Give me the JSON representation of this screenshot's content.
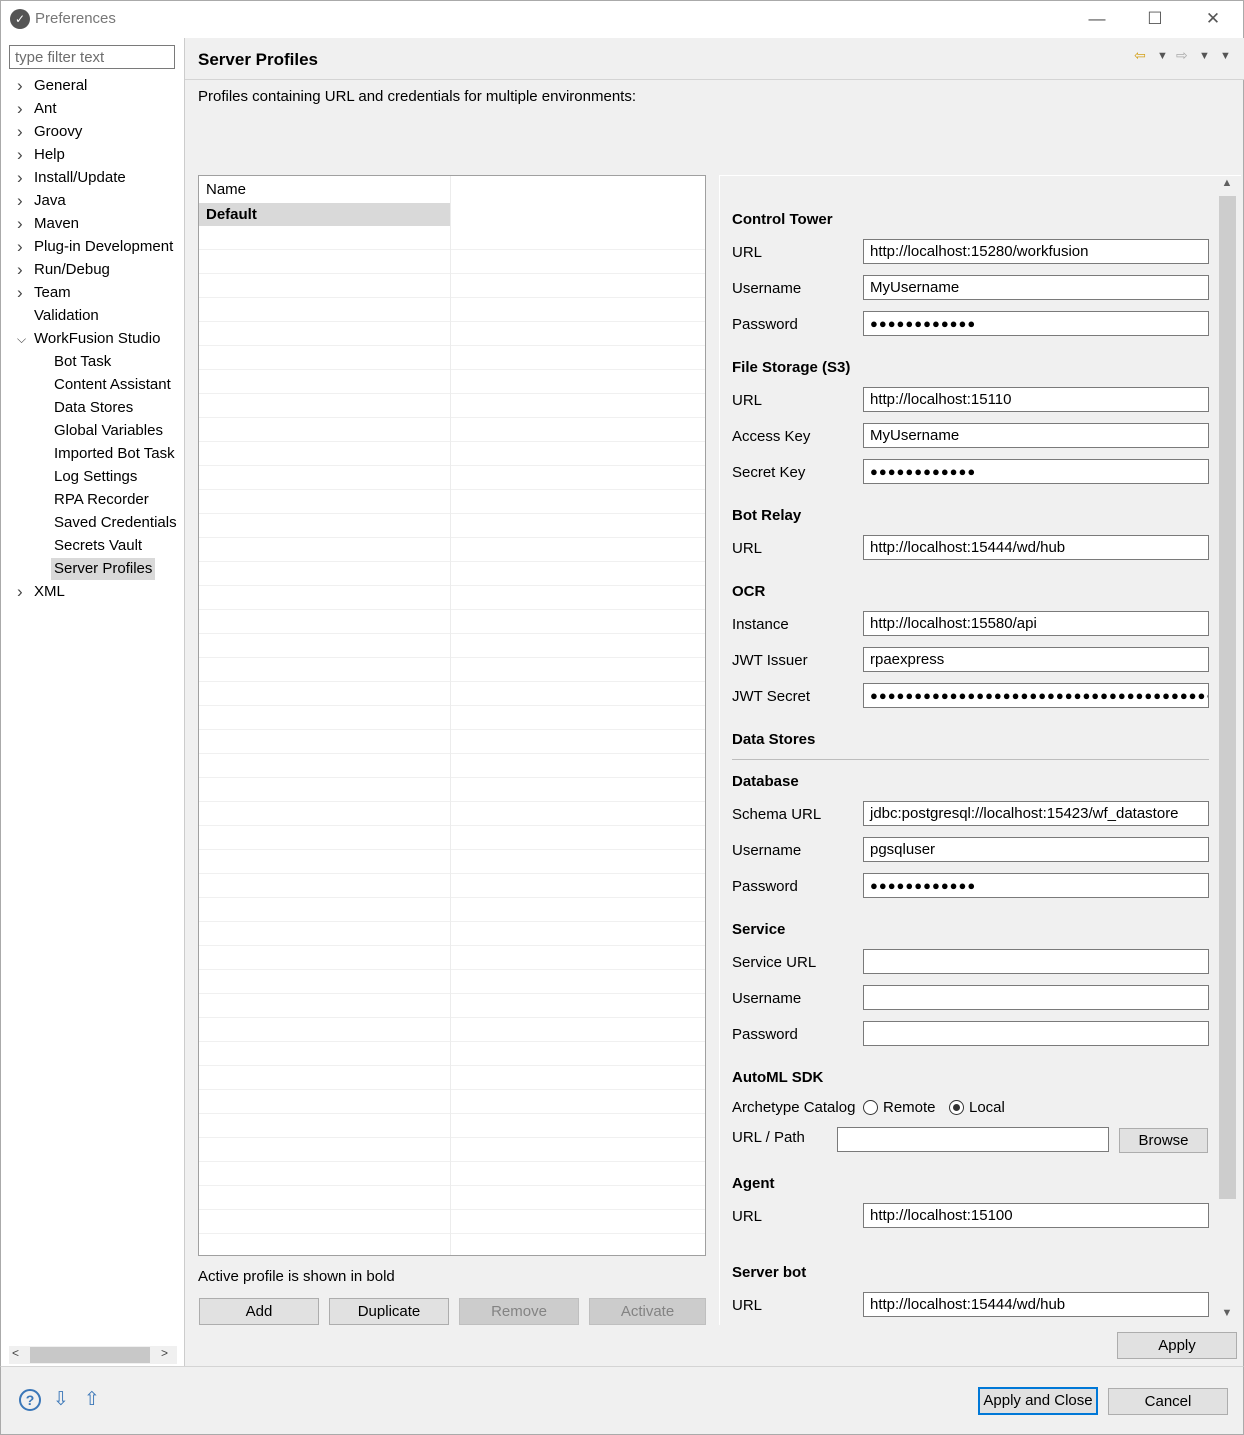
{
  "window": {
    "title": "Preferences",
    "min": "—",
    "max": "☐",
    "close": "✕"
  },
  "filter": {
    "placeholder": "type filter text"
  },
  "tree": {
    "top": [
      "General",
      "Ant",
      "Groovy",
      "Help",
      "Install/Update",
      "Java",
      "Maven",
      "Plug-in Development",
      "Run/Debug",
      "Team",
      "Validation",
      "WorkFusion Studio"
    ],
    "children": [
      "Bot Task",
      "Content Assistant",
      "Data Stores",
      "Global Variables",
      "Imported Bot Task",
      "Log Settings",
      "RPA Recorder",
      "Saved Credentials",
      "Secrets Vault",
      "Server Profiles"
    ],
    "last": "XML",
    "selected": "Server Profiles"
  },
  "page": {
    "title": "Server Profiles",
    "description": "Profiles containing URL and credentials for multiple environments:"
  },
  "table": {
    "header": "Name",
    "rows": [
      "Default"
    ],
    "note": "Active profile is shown in bold"
  },
  "buttons": {
    "add": "Add",
    "duplicate": "Duplicate",
    "remove": "Remove",
    "activate": "Activate",
    "browse": "Browse",
    "apply": "Apply",
    "apply_close": "Apply and Close",
    "cancel": "Cancel"
  },
  "form": {
    "control_tower": {
      "title": "Control Tower",
      "url_label": "URL",
      "url": "http://localhost:15280/workfusion",
      "user_label": "Username",
      "user": "MyUsername",
      "pw_label": "Password",
      "pw": "●●●●●●●●●●●●"
    },
    "file_storage": {
      "title": "File Storage (S3)",
      "url_label": "URL",
      "url": "http://localhost:15110",
      "key_label": "Access Key",
      "key": "MyUsername",
      "secret_label": "Secret Key",
      "secret": "●●●●●●●●●●●●"
    },
    "bot_relay": {
      "title": "Bot Relay",
      "url_label": "URL",
      "url": "http://localhost:15444/wd/hub"
    },
    "ocr": {
      "title": "OCR",
      "instance_label": "Instance",
      "instance": "http://localhost:15580/api",
      "issuer_label": "JWT Issuer",
      "issuer": "rpaexpress",
      "secret_label": "JWT Secret",
      "secret": "●●●●●●●●●●●●●●●●●●●●●●●●●●●●●●●●●●●●●●●●●"
    },
    "data_stores": {
      "title": "Data Stores"
    },
    "database": {
      "title": "Database",
      "schema_label": "Schema URL",
      "schema": "jdbc:postgresql://localhost:15423/wf_datastore",
      "user_label": "Username",
      "user": "pgsqluser",
      "pw_label": "Password",
      "pw": "●●●●●●●●●●●●"
    },
    "service": {
      "title": "Service",
      "url_label": "Service URL",
      "url": "",
      "user_label": "Username",
      "user": "",
      "pw_label": "Password",
      "pw": ""
    },
    "automl": {
      "title": "AutoML SDK",
      "catalog_label": "Archetype Catalog",
      "remote": "Remote",
      "local": "Local",
      "selected": "Local",
      "path_label": "URL / Path",
      "path": ""
    },
    "agent": {
      "title": "Agent",
      "url_label": "URL",
      "url": "http://localhost:15100"
    },
    "server_bot": {
      "title": "Server bot",
      "url_label": "URL",
      "url": "http://localhost:15444/wd/hub"
    }
  },
  "icons": {
    "help": "?",
    "import": "⇩",
    "export": "⇧"
  }
}
